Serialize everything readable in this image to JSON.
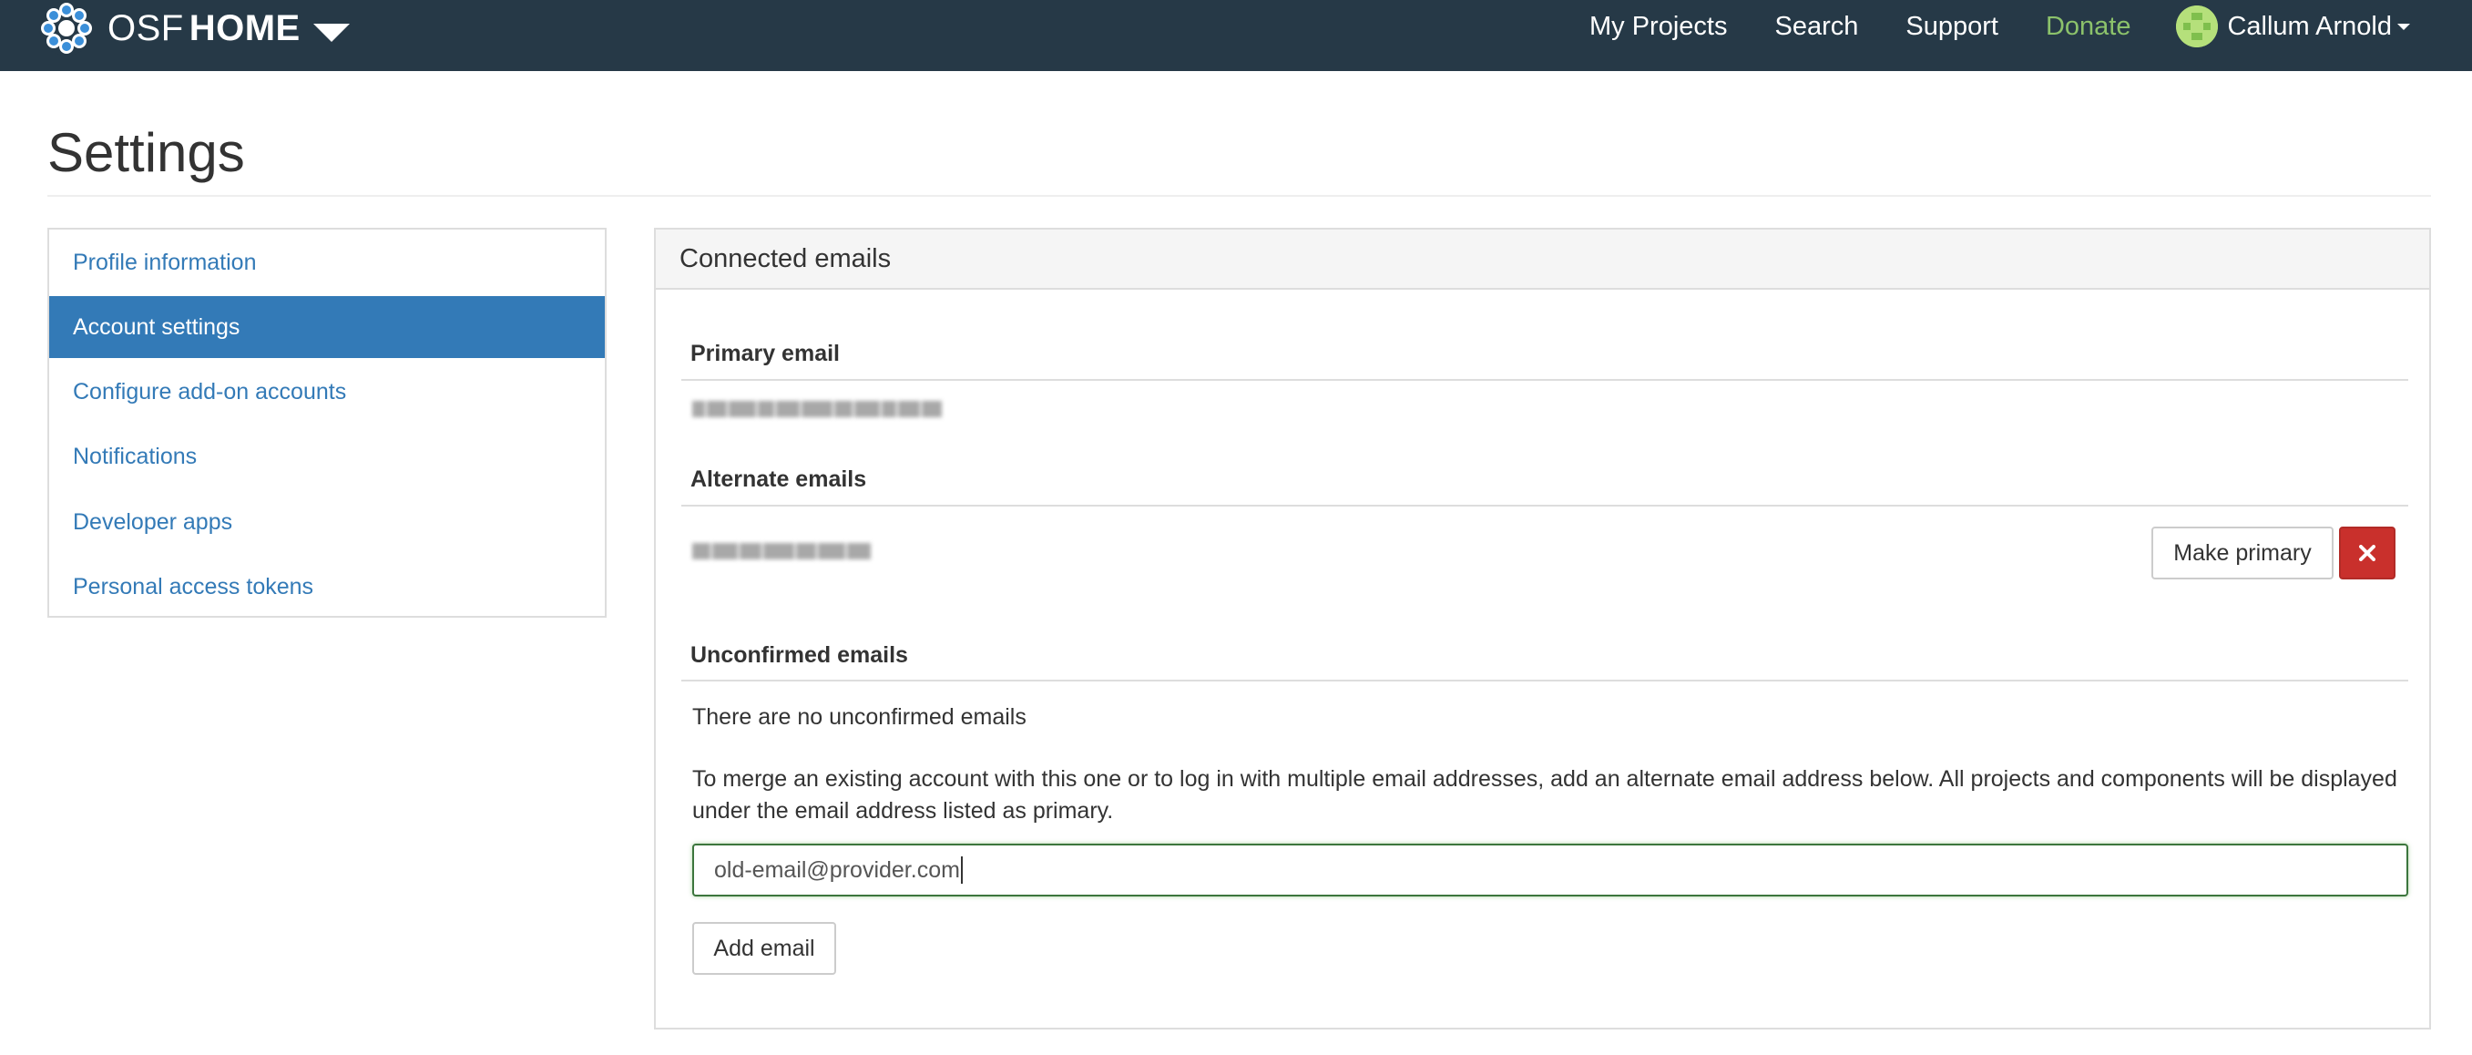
{
  "navbar": {
    "brand_primary": "OSF",
    "brand_secondary": "HOME",
    "links": {
      "my_projects": "My Projects",
      "search": "Search",
      "support": "Support",
      "donate": "Donate"
    },
    "user_name": "Callum Arnold"
  },
  "page": {
    "title": "Settings"
  },
  "sidebar": {
    "items": [
      {
        "label": "Profile information",
        "active": false
      },
      {
        "label": "Account settings",
        "active": true
      },
      {
        "label": "Configure add-on accounts",
        "active": false
      },
      {
        "label": "Notifications",
        "active": false
      },
      {
        "label": "Developer apps",
        "active": false
      },
      {
        "label": "Personal access tokens",
        "active": false
      }
    ]
  },
  "panel": {
    "heading": "Connected emails",
    "primary": {
      "heading": "Primary email"
    },
    "alternate": {
      "heading": "Alternate emails",
      "make_primary_label": "Make primary"
    },
    "unconfirmed": {
      "heading": "Unconfirmed emails",
      "empty_text": "There are no unconfirmed emails"
    },
    "merge_help": "To merge an existing account with this one or to log in with multiple email addresses, add an alternate email address below. All projects and components will be displayed under the email address listed as primary.",
    "email_input_value": "old-email@provider.com",
    "add_email_label": "Add email"
  },
  "colors": {
    "navbar_bg": "#263947",
    "link": "#337ab7",
    "active_bg": "#337ab7",
    "donate": "#8cc26b",
    "danger": "#c9302c",
    "input_success_border": "#3c763d"
  },
  "icons": [
    "osf-logo-icon",
    "chevron-down-icon",
    "avatar",
    "caret-down-icon",
    "close-icon"
  ]
}
